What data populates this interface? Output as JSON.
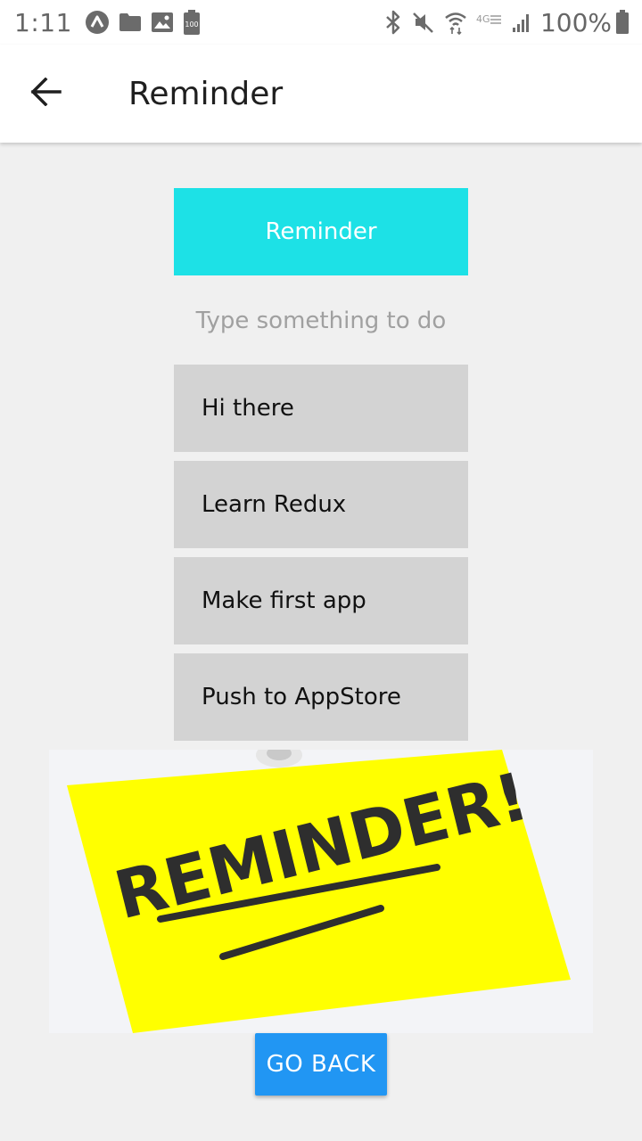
{
  "status_bar": {
    "time": "1:11",
    "battery_percent": "100%",
    "left_icons": [
      "app-a-icon",
      "folder-icon",
      "image-icon",
      "battery-saver-icon"
    ],
    "left_icon_text": "100",
    "network_label": "4G",
    "right_icons": [
      "bluetooth-icon",
      "mute-icon",
      "wifi-icon",
      "network-type-icon",
      "signal-icon",
      "battery-icon"
    ]
  },
  "app_bar": {
    "back_icon": "arrow-left-icon",
    "title": "Reminder"
  },
  "main": {
    "header_label": "Reminder",
    "header_color": "#1de1e6",
    "input_value": "",
    "input_placeholder": "Type something to do",
    "todos": [
      {
        "label": "Hi there"
      },
      {
        "label": "Learn Redux"
      },
      {
        "label": "Make first app"
      },
      {
        "label": "Push to AppStore"
      }
    ],
    "image": {
      "text": "REMINDER!",
      "note_color": "#ffff00"
    },
    "go_back_label": "GO BACK",
    "go_back_color": "#2196f3"
  }
}
